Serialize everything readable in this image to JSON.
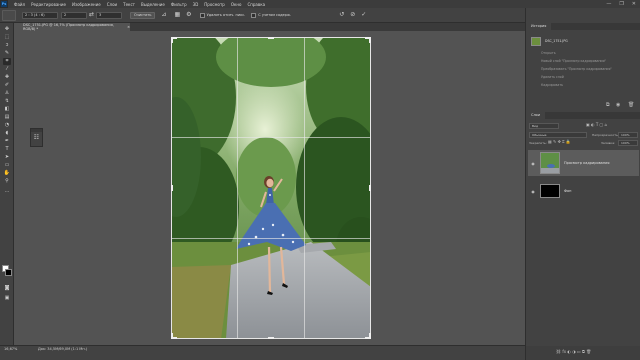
{
  "app": {
    "logo": "Ps"
  },
  "menubar": {
    "items": [
      "Файл",
      "Редактирование",
      "Изображение",
      "Слои",
      "Текст",
      "Выделение",
      "Фильтр",
      "3D",
      "Просмотр",
      "Окно",
      "Справка"
    ],
    "window_controls": [
      "—",
      "❐",
      "✕"
    ]
  },
  "options": {
    "aspect": "2 : 3 (4 : 6)",
    "width": "2",
    "height": "3",
    "clear_label": "Очистить",
    "straighten_icon": "straighten-icon",
    "delete_pixels_label": "Удалить отсеч. пикс.",
    "content_aware_label": "С учетом содерж.",
    "icons": [
      "reset-icon",
      "cancel-icon",
      "commit-icon"
    ]
  },
  "document": {
    "tab_label": "DSC_1751.JPG @ 16,7% (Просмотр кадрирования, RGB/8) *",
    "close_icon": "×"
  },
  "status": {
    "zoom": "16,67%",
    "doc_info": "Док: 34,5M/69,0M (1:1 Мн.)"
  },
  "history": {
    "tab": "История",
    "snapshot": "DSC_1751.JPG",
    "items": [
      "Открыть",
      "Новый слой \"Просмотр кадрирования\"",
      "Преобразовать \"Просмотр кадрирования\"",
      "Удалить слой",
      "Кадрировать"
    ]
  },
  "layers": {
    "tab": "Слои",
    "kind_label": "Вид",
    "blend_mode": "Обычные",
    "opacity_label": "Непрозрачность:",
    "opacity": "100%",
    "fill_label": "Заливка:",
    "fill": "100%",
    "lock_label": "Закрепить:",
    "rows": [
      {
        "name": "Просмотр кадрирования",
        "selected": true
      },
      {
        "name": "Фон",
        "selected": false
      }
    ]
  },
  "colors": {
    "foreground": "#ffffff",
    "background": "#000000"
  }
}
